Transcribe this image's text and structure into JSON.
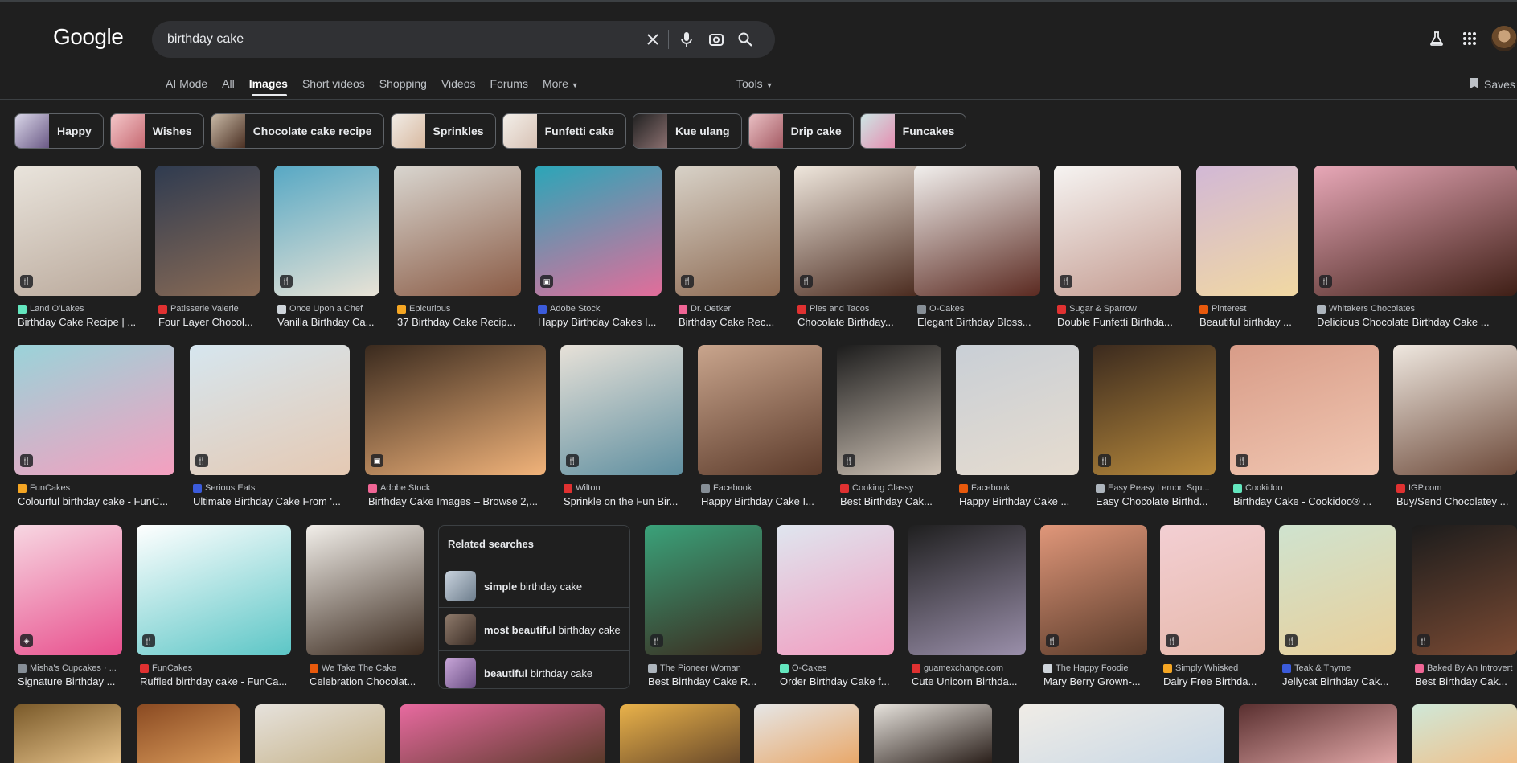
{
  "header": {
    "logo": "Google",
    "query": "birthday cake"
  },
  "tabs": [
    {
      "label": "AI Mode"
    },
    {
      "label": "All"
    },
    {
      "label": "Images"
    },
    {
      "label": "Short videos"
    },
    {
      "label": "Shopping"
    },
    {
      "label": "Videos"
    },
    {
      "label": "Forums"
    },
    {
      "label": "More"
    }
  ],
  "tools_label": "Tools",
  "saves_label": "Saves",
  "chips": [
    {
      "label": "Happy"
    },
    {
      "label": "Wishes"
    },
    {
      "label": "Chocolate cake recipe"
    },
    {
      "label": "Sprinkles"
    },
    {
      "label": "Funfetti cake"
    },
    {
      "label": "Kue ulang"
    },
    {
      "label": "Drip cake"
    },
    {
      "label": "Funcakes"
    }
  ],
  "row1": [
    {
      "source": "Land O'Lakes",
      "title": "Birthday Cake Recipe | ..."
    },
    {
      "source": "Patisserie Valerie",
      "title": "Four Layer Chocol..."
    },
    {
      "source": "Once Upon a Chef",
      "title": "Vanilla Birthday Ca..."
    },
    {
      "source": "Epicurious",
      "title": "37 Birthday Cake Recip..."
    },
    {
      "source": "Adobe Stock",
      "title": "Happy Birthday Cakes I..."
    },
    {
      "source": "Dr. Oetker",
      "title": "Birthday Cake Rec..."
    },
    {
      "source": "Pies and Tacos",
      "title": "Chocolate Birthday..."
    },
    {
      "source": "O-Cakes",
      "title": "Elegant Birthday Bloss..."
    },
    {
      "source": "Sugar & Sparrow",
      "title": "Double Funfetti Birthda..."
    },
    {
      "source": "Pinterest",
      "title": "Beautiful birthday ..."
    },
    {
      "source": "Whitakers Chocolates",
      "title": "Delicious Chocolate Birthday Cake ..."
    }
  ],
  "row2": [
    {
      "source": "FunCakes",
      "title": "Colourful birthday cake - FunC..."
    },
    {
      "source": "Serious Eats",
      "title": "Ultimate Birthday Cake From '..."
    },
    {
      "source": "Adobe Stock",
      "title": "Birthday Cake Images – Browse 2,..."
    },
    {
      "source": "Wilton",
      "title": "Sprinkle on the Fun Bir..."
    },
    {
      "source": "Facebook",
      "title": "Happy Birthday Cake I..."
    },
    {
      "source": "Cooking Classy",
      "title": "Best Birthday Cak..."
    },
    {
      "source": "Facebook",
      "title": "Happy Birthday Cake ..."
    },
    {
      "source": "Easy Peasy Lemon Squ...",
      "title": "Easy Chocolate Birthd..."
    },
    {
      "source": "Cookidoo",
      "title": "Birthday Cake - Cookidoo® ..."
    },
    {
      "source": "IGP.com",
      "title": "Buy/Send Chocolatey ..."
    }
  ],
  "row3": [
    {
      "source": "Misha's Cupcakes · ...",
      "title": "Signature Birthday ..."
    },
    {
      "source": "FunCakes",
      "title": "Ruffled birthday cake - FunCa..."
    },
    {
      "source": "We Take The Cake",
      "title": "Celebration Chocolat..."
    },
    {
      "source": "The Pioneer Woman",
      "title": "Best Birthday Cake R..."
    },
    {
      "source": "O-Cakes",
      "title": "Order Birthday Cake f..."
    },
    {
      "source": "guamexchange.com",
      "title": "Cute Unicorn Birthda..."
    },
    {
      "source": "The Happy Foodie",
      "title": "Mary Berry Grown-..."
    },
    {
      "source": "Simply Whisked",
      "title": "Dairy Free Birthda..."
    },
    {
      "source": "Teak & Thyme",
      "title": "Jellycat Birthday Cak..."
    },
    {
      "source": "Baked By An Introvert",
      "title": "Best Birthday Cak..."
    }
  ],
  "related": {
    "heading": "Related searches",
    "items": [
      {
        "bold": "simple",
        "rest": " birthday cake"
      },
      {
        "bold": "most beautiful",
        "rest": " birthday cake"
      },
      {
        "bold": "beautiful",
        "rest": " birthday cake"
      }
    ]
  },
  "icons": {
    "clear": "close-icon",
    "voice": "mic-icon",
    "lens": "camera-lens-icon",
    "search": "search-icon",
    "labs": "flask-icon",
    "apps": "grid-icon",
    "saves": "bookmark-icon"
  }
}
